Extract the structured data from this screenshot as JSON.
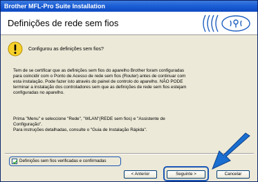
{
  "window": {
    "title": "Brother MFL-Pro Suite Installation"
  },
  "header": {
    "title": "Definições de rede sem fios"
  },
  "message": {
    "question": "Configurou as definições sem fios?"
  },
  "body": {
    "paragraph": "Tem de se certificar que as definições sem fios do aparelho Brother foram configuradas\npara coincidir com o Ponto de Acesso de rede sem fios (Router) antes de continuar com\nesta instalação. Pode fazer isto através do painel de controlo do aparelho. NÃO PODE\nterminar a instalação dos controladores sem que as definições de rede sem fios estejam\nconfiguradas no aparelho.",
    "instructions": "Prima \"Menu\" e seleccione \"Rede\", \"WLAN\"(REDE sem fios) e \"Assistente de\nConfiguração\".\nPara instruções detalhadas, consulte o \"Guia de Instalação Rápida\"."
  },
  "checkbox": {
    "label": "Definições sem fios verificadas e confirmadas",
    "checked": true
  },
  "buttons": {
    "back": "< Anterior",
    "next": "Seguinte >",
    "cancel": "Cancelar"
  },
  "colors": {
    "titlebar": "#1c5fd6",
    "highlight": "#1a56b6",
    "logo": "#1f5fbf"
  }
}
